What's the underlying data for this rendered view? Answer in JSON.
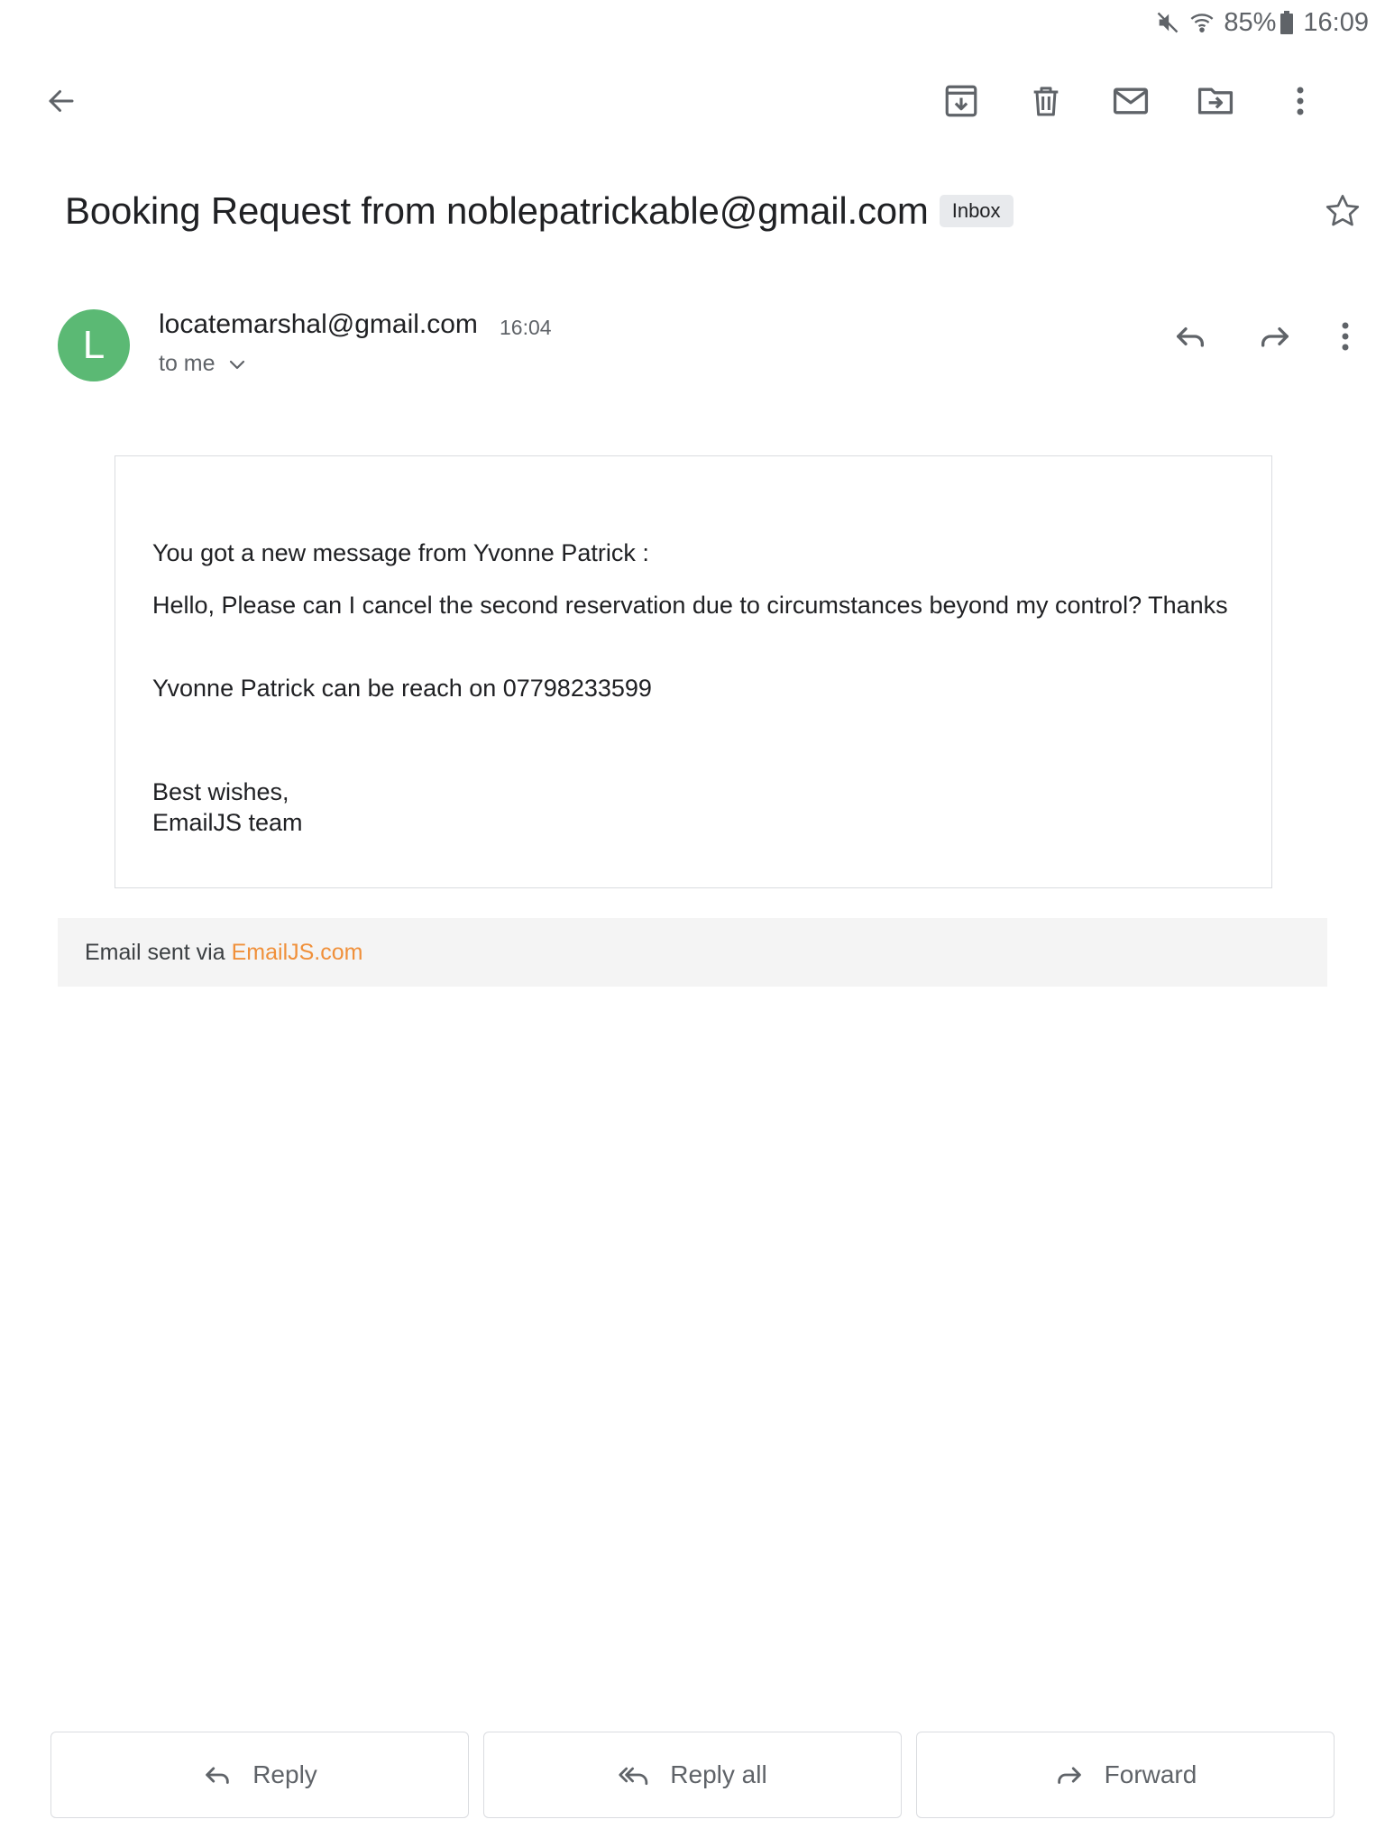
{
  "status_bar": {
    "battery": "85%",
    "time": "16:09",
    "icons": [
      "mute-icon",
      "wifi-icon",
      "battery-icon"
    ]
  },
  "toolbar": {
    "icons": [
      "back-arrow-icon",
      "archive-icon",
      "trash-icon",
      "mail-icon",
      "move-to-folder-icon",
      "more-vert-icon"
    ]
  },
  "email": {
    "subject": "Booking Request from noblepatrickable@gmail.com",
    "label": "Inbox",
    "sender": {
      "initial": "L",
      "email": "locatemarshal@gmail.com",
      "time": "16:04",
      "recipient": "to me"
    },
    "body": {
      "intro": "You got a new message from Yvonne Patrick :",
      "message": "Hello, Please can I cancel the second reservation due to circumstances beyond my control? Thanks",
      "contact": "Yvonne Patrick can be reach on 07798233599",
      "closing_line1": "Best wishes,",
      "closing_line2": "EmailJS team"
    },
    "footer": {
      "prefix": "Email sent via",
      "link": "EmailJS.com"
    }
  },
  "actions": {
    "reply": "Reply",
    "reply_all": "Reply all",
    "forward": "Forward"
  },
  "colors": {
    "avatar": "#5bb974",
    "link": "#f0903a",
    "icon": "#5f6368"
  }
}
